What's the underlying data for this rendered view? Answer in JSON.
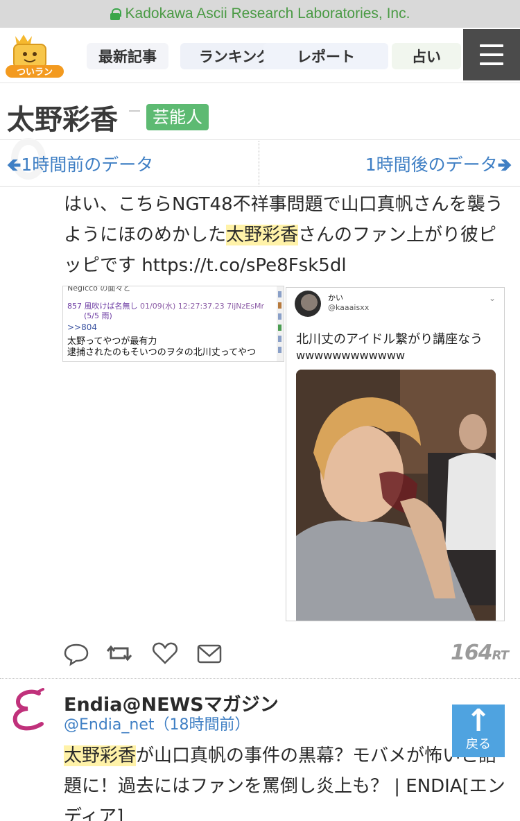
{
  "browser": {
    "url": "Kadokawa Ascii Research Laboratories, Inc."
  },
  "nav": {
    "logo_text": "ついラン",
    "items": [
      {
        "label": "最新記事"
      },
      {
        "label": "ランキング"
      },
      {
        "label": "レポート"
      },
      {
        "label": "占い"
      }
    ]
  },
  "header": {
    "title": "太野彩香",
    "tag": "芸能人"
  },
  "time_nav": {
    "prev": "1時間前のデータ",
    "next": "1時間後のデータ"
  },
  "tweet1": {
    "text_before": "はい、こちらNGT48不祥事問題で山口真帆さんを襲うようにほのめかした",
    "highlight": "太野彩香",
    "text_after": "さんのファン上がり彼ピッピです https://t.co/sPe8Fsk5dl",
    "image_left": {
      "line0": "Negicco の面々と",
      "post_no": "857",
      "post_name": "風吹けば名無し",
      "post_date": "01/09(水) 12:27:37.23 7ijNzEsMr",
      "post_sub": "(5/5 雨)",
      "reply_ref": ">>804",
      "line1": "太野ってやつが最有力",
      "line2": "逮捕されたのもそいつのヲタの北川丈ってやつ"
    },
    "image_right": {
      "name": "かい",
      "handle": "@kaaaisxx",
      "text": "北川丈のアイドル繋がり講座なう",
      "text2": "wwwwwwwwwwww"
    },
    "retweets": "164",
    "rt_suffix": "RT"
  },
  "tweet2": {
    "author": "Endia@NEWSマガジン",
    "handle": "@Endia_net",
    "time_ago": "（18時間前）",
    "highlight": "太野彩香",
    "text_after": "が山口真帆の事件の黒幕？モバメが怖いと話題に！過去にはファンを罵倒し炎上も？ | ENDIA[エンディア]"
  },
  "back_button": {
    "label": "戻る"
  },
  "colors": {
    "accent_blue": "#3f7fc4",
    "tag_green": "#5dba72",
    "highlight": "#fff2a8",
    "menu_bg": "#4b4b4b",
    "back_btn": "#4fa3e0"
  }
}
